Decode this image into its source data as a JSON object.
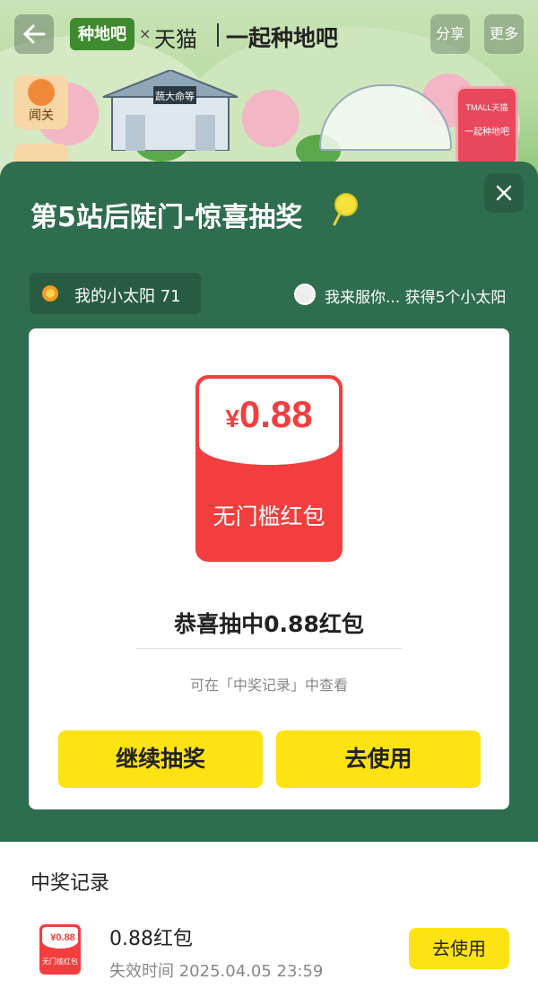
{
  "header": {
    "brand_logo": "种地吧",
    "brand_x": "×",
    "brand_partner": "天猫",
    "title": "一起种地吧",
    "share_label": "分享",
    "more_label": "更多"
  },
  "scene": {
    "side_icon_label": "闻关",
    "house_sign": "蔬大命等",
    "tmall_sign": "TMALL天猫",
    "tmall_sign_sub": "一起种地吧"
  },
  "modal": {
    "title": "第5站后陡门-惊喜抽奖",
    "sun_label": "我的小太阳",
    "sun_count": "71",
    "winner_note": "我来服你... 获得5个小太阳",
    "prize": {
      "currency": "¥",
      "amount": "0.88",
      "coupon_label": "无门槛红包",
      "message": "恭喜抽中0.88红包",
      "hint": "可在「中奖记录」中查看",
      "continue_label": "继续抽奖",
      "use_label": "去使用"
    }
  },
  "records": {
    "title": "中奖记录",
    "items": [
      {
        "thumb_amount": "¥0.88",
        "thumb_label": "无门槛红包",
        "name": "0.88红包",
        "expiry": "失效时间 2025.04.05 23:59",
        "action": "去使用"
      }
    ]
  },
  "colors": {
    "panel": "#2e6d4e",
    "accent_yellow": "#fde312",
    "coupon_red": "#f23e3e"
  }
}
